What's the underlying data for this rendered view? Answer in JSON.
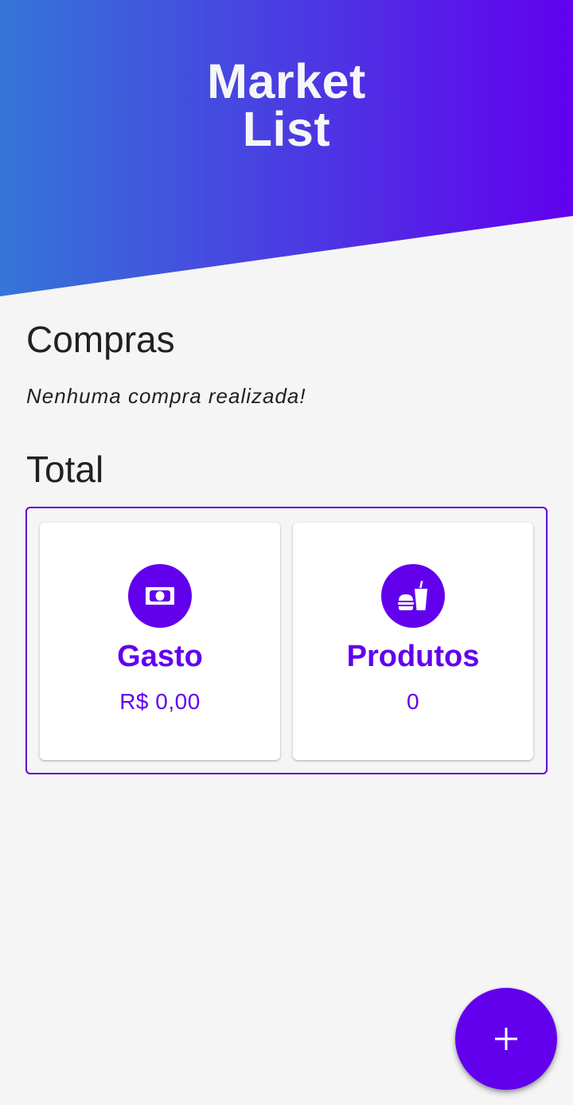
{
  "header": {
    "title_line1": "Market",
    "title_line2": "List"
  },
  "compras": {
    "title": "Compras",
    "empty_message": "Nenhuma compra realizada!"
  },
  "total": {
    "title": "Total",
    "cards": [
      {
        "label": "Gasto",
        "value": "R$ 0,00",
        "icon": "money-bill-icon"
      },
      {
        "label": "Produtos",
        "value": "0",
        "icon": "fast-food-icon"
      }
    ]
  },
  "fab": {
    "icon": "plus-icon"
  },
  "colors": {
    "accent": "#6200ee",
    "header_gradient_start": "#3575d8",
    "header_gradient_end": "#6200ee",
    "background": "#f5f5f5"
  }
}
